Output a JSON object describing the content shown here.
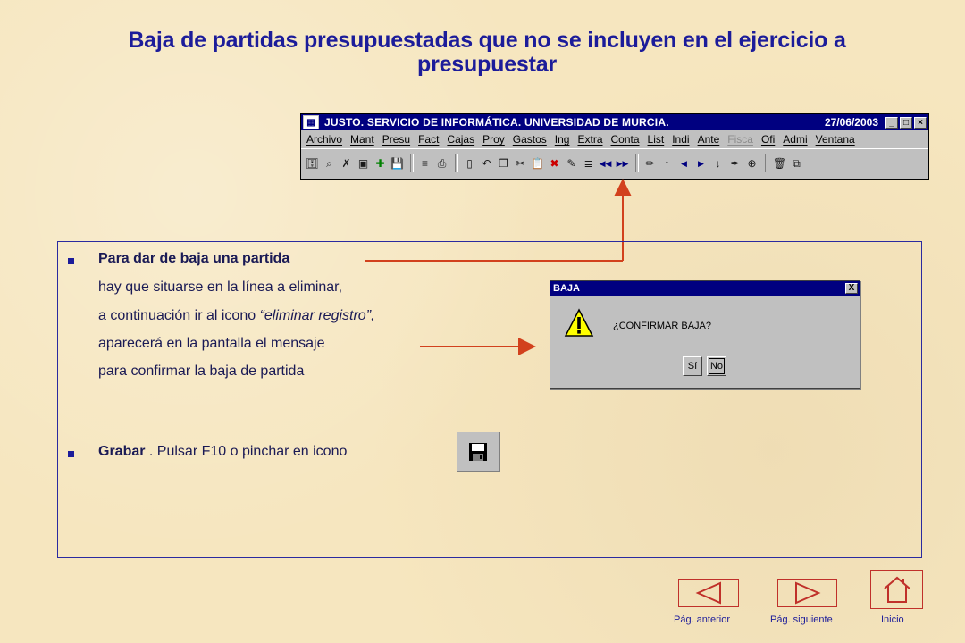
{
  "title": {
    "line1": "Baja de partidas presupuestadas que no se incluyen en el ejercicio a",
    "line2": "presupuestar"
  },
  "app": {
    "window_title": "JUSTO. SERVICIO DE INFORMÁTICA. UNIVERSIDAD DE MURCIA.",
    "date": "27/06/2003",
    "window_controls": {
      "minimize": "_",
      "maximize": "□",
      "close": "×"
    },
    "menu": [
      "Archivo",
      "Mant",
      "Presu",
      "Fact",
      "Cajas",
      "Proy",
      "Gastos",
      "Ing",
      "Extra",
      "Conta",
      "List",
      "Indi",
      "Ante",
      "Fisca",
      "Ofi",
      "Admi",
      "Ventana"
    ],
    "menu_disabled": "Fisca",
    "toolbar_icons": [
      "query-icon",
      "find-icon",
      "clear-icon",
      "run-icon",
      "add-record-icon",
      "save-icon",
      "sep",
      "edit-list-icon",
      "print-icon",
      "sep",
      "exit-door-icon",
      "undo-icon",
      "copy-icon",
      "cut-icon",
      "paste-icon",
      "delete-record-icon",
      "insert-icon",
      "duplicate-icon",
      "first-icon",
      "last-icon",
      "sep",
      "pencil-icon",
      "up-arrow-icon",
      "prev-icon",
      "next-icon",
      "down-arrow-icon",
      "pen-icon",
      "zoom-icon",
      "sep",
      "trash-icon",
      "window-icon"
    ]
  },
  "content": {
    "bullet1_title": "Para dar de baja una partida",
    "bullet1_line2": "hay que situarse en la línea a eliminar,",
    "bullet1_line3_pre": "a continuación ir al icono ",
    "bullet1_line3_em": "“eliminar registro”,",
    "bullet1_line4": "aparecerá en la pantalla el mensaje",
    "bullet1_line5": "para confirmar la baja de partida",
    "bullet2_title": "Grabar",
    "bullet2_text": " . Pulsar F10 o pinchar en icono"
  },
  "dialog": {
    "title": "BAJA",
    "close": "X",
    "message": "¿CONFIRMAR BAJA?",
    "yes": "Sí",
    "no": "No"
  },
  "nav": {
    "prev_label": "Pág. anterior",
    "next_label": "Pág. siguiente",
    "home_label": "Inicio"
  },
  "colors": {
    "title": "#1c1c9a",
    "arrow": "#d2411d",
    "background": "#f6e6bf"
  }
}
